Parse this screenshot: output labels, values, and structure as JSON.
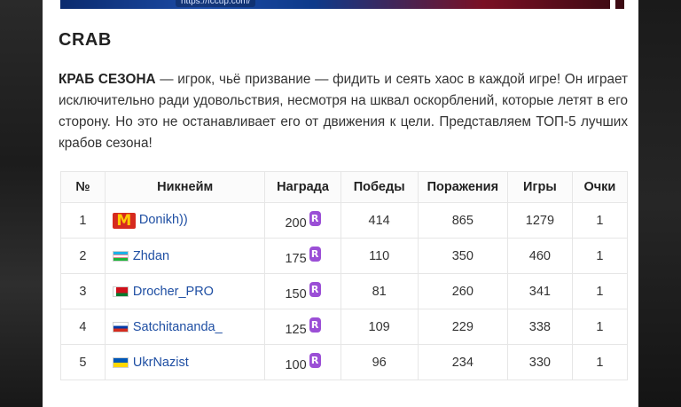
{
  "banner": {
    "url_text": "https://fccup.com/"
  },
  "section": {
    "title": "CRAB",
    "description_bold": "КРАБ СЕЗОНА",
    "description_rest": " — игрок, чьё призвание — фидить и сеять хаос в каждой игре! Он играет исключительно ради удовольствия, несмотря на шквал оскорблений, которые летят в его сторону. Но это не останавливает его от движения к цели. Представляем ТОП-5 лучших крабов сезона!"
  },
  "table": {
    "headers": [
      "№",
      "Никнейм",
      "Награда",
      "Победы",
      "Поражения",
      "Игры",
      "Очки"
    ],
    "rows": [
      {
        "rank": "1",
        "nickname": "Donikh))",
        "flag": "mcdonalds-icon",
        "reward": "200",
        "wins": "414",
        "losses": "865",
        "games": "1279",
        "points": "1"
      },
      {
        "rank": "2",
        "nickname": "Zhdan",
        "flag": "flag-uz-icon",
        "reward": "175",
        "wins": "110",
        "losses": "350",
        "games": "460",
        "points": "1"
      },
      {
        "rank": "3",
        "nickname": "Drocher_PRO",
        "flag": "flag-by-icon",
        "reward": "150",
        "wins": "81",
        "losses": "260",
        "games": "341",
        "points": "1"
      },
      {
        "rank": "4",
        "nickname": "Satchitananda_",
        "flag": "flag-ru-icon",
        "reward": "125",
        "wins": "109",
        "losses": "229",
        "games": "338",
        "points": "1"
      },
      {
        "rank": "5",
        "nickname": "UkrNazist",
        "flag": "flag-ua-icon",
        "reward": "100",
        "wins": "96",
        "losses": "234",
        "games": "330",
        "points": "1"
      }
    ]
  },
  "colors": {
    "link": "#1f4fa3",
    "coin": "#9b4fd6"
  }
}
